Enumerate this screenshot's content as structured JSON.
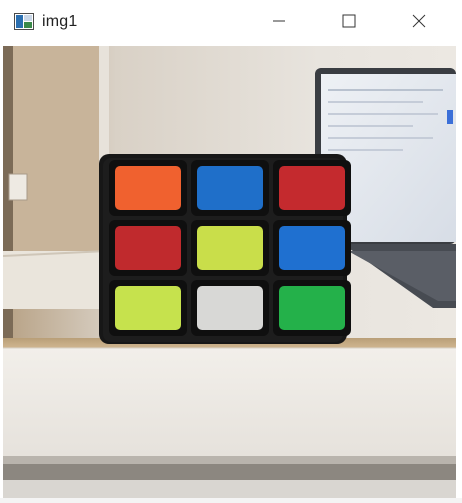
{
  "window": {
    "title": "img1",
    "controls": {
      "minimize_icon": "minimize-icon",
      "maximize_icon": "maximize-icon",
      "close_icon": "close-icon"
    }
  },
  "image": {
    "subject": "rubiks-cube-photo",
    "cube_faces": [
      [
        "#f0612f",
        "#1f6fc9",
        "#c42a2e"
      ],
      [
        "#c02a2d",
        "#c9de4a",
        "#1f70d0"
      ],
      [
        "#c6e24d",
        "#d8d8d6",
        "#24b14a"
      ]
    ]
  }
}
